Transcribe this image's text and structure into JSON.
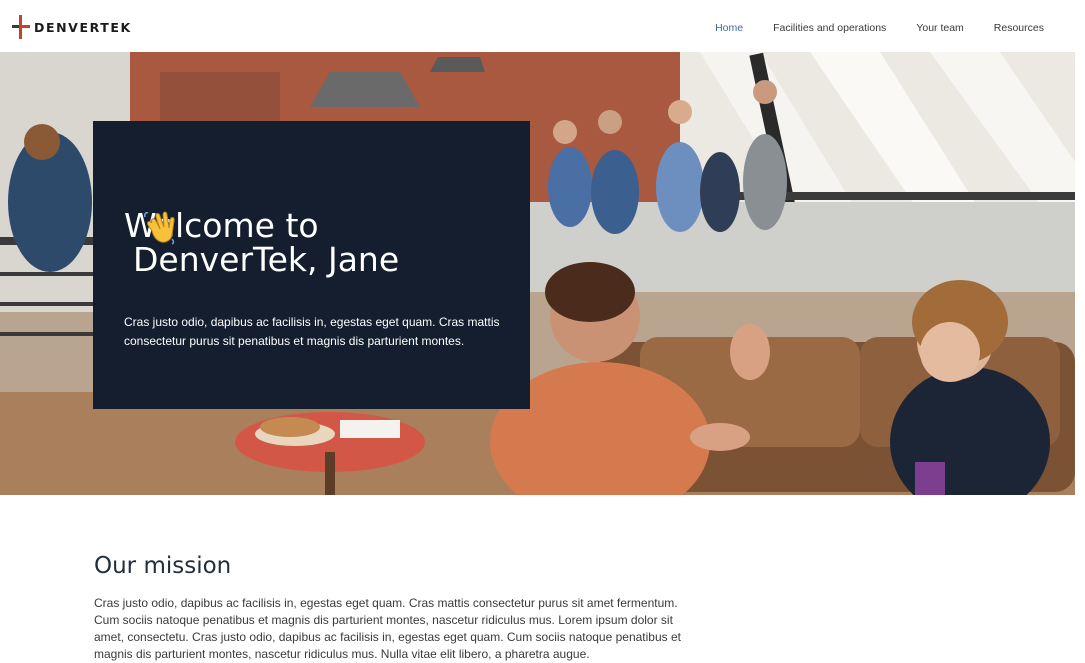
{
  "brand": {
    "logo_text": "DENVERTEK",
    "accent": "#c8402b"
  },
  "nav": {
    "items": [
      {
        "label": "Home",
        "active": true
      },
      {
        "label": "Facilities and operations",
        "active": false
      },
      {
        "label": "Your team",
        "active": false
      },
      {
        "label": "Resources",
        "active": false
      }
    ]
  },
  "hero": {
    "title_line1": "Welcome to",
    "title_line2": "DenverTek, Jane",
    "emoji": "waving-hand-icon",
    "text": "Cras justo odio, dapibus ac facilisis in, egestas eget quam. Cras mattis consectetur purus sit penatibus et magnis dis parturient montes.",
    "card_color": "#141e2e"
  },
  "mission": {
    "title": "Our mission",
    "text": "Cras justo odio, dapibus ac facilisis in, egestas eget quam. Cras mattis consectetur purus sit amet fermentum. Cum sociis natoque penatibus et magnis dis parturient montes, nascetur ridiculus mus. Lorem ipsum dolor sit amet, consectetu. Cras justo odio, dapibus ac facilisis in, egestas eget quam. Cum sociis natoque penatibus et magnis dis parturient montes, nascetur ridiculus mus. Nulla vitae elit libero, a pharetra augue."
  }
}
